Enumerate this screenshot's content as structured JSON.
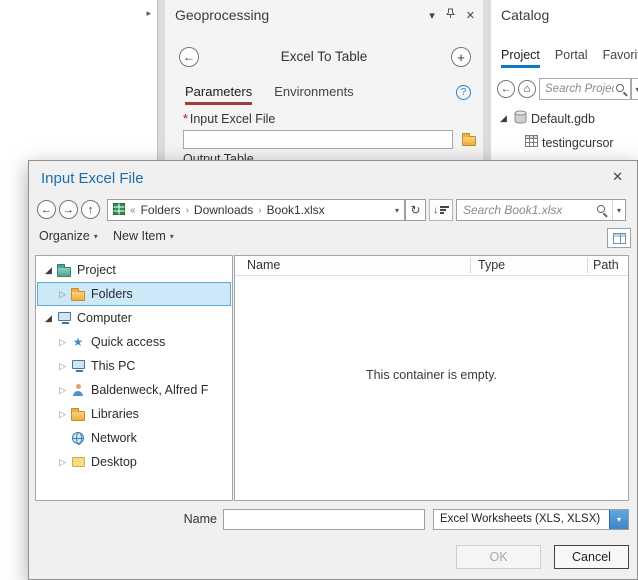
{
  "colors": {
    "accent_blue": "#0a7ac3",
    "title_blue": "#1a6fae",
    "selection_fill": "#cde8f7",
    "selection_border": "#5fa8dc",
    "required_red": "#c00000",
    "parameters_underline": "#a33c3c",
    "combo_button_blue": "#3c86c6"
  },
  "icons": {
    "back": "←",
    "forward": "→",
    "up": "↑",
    "refresh": "↻",
    "dropdown": "▾",
    "close": "✕",
    "plus": "+",
    "help": "?",
    "home": "⌂",
    "collapsed": "▷",
    "expanded": "◢",
    "crumb_overflow": "«",
    "crumb_sep": "›",
    "pane_arrow": "▸",
    "star": "★",
    "sort_down": "↓"
  },
  "geoprocessing": {
    "title": "Geoprocessing",
    "tool_title": "Excel To Table",
    "tab_parameters": "Parameters",
    "tab_environments": "Environments",
    "required_marker": "*",
    "input_label": "Input Excel File",
    "partial_label": "Output Table"
  },
  "catalog": {
    "title": "Catalog",
    "tab_project": "Project",
    "tab_portal": "Portal",
    "tab_favorites": "Favorites",
    "search_placeholder": "Search Project",
    "gdb_label": "Default.gdb",
    "table_label": "testingcursor"
  },
  "dialog": {
    "title": "Input Excel File",
    "crumbs": [
      "Folders",
      "Downloads",
      "Book1.xlsx"
    ],
    "search_placeholder": "Search Book1.xlsx",
    "organize_label": "Organize",
    "new_item_label": "New Item",
    "tree": [
      {
        "label": "Project"
      },
      {
        "label": "Folders"
      },
      {
        "label": "Computer"
      },
      {
        "label": "Quick access"
      },
      {
        "label": "This PC"
      },
      {
        "label": "Baldenweck, Alfred F"
      },
      {
        "label": "Libraries"
      },
      {
        "label": "Network"
      },
      {
        "label": "Desktop"
      }
    ],
    "columns": [
      "Name",
      "Type",
      "Path"
    ],
    "empty_text": "This container is empty.",
    "name_label": "Name",
    "name_value": "",
    "file_type_value": "Excel Worksheets (XLS, XLSX)",
    "ok_label": "OK",
    "cancel_label": "Cancel"
  }
}
